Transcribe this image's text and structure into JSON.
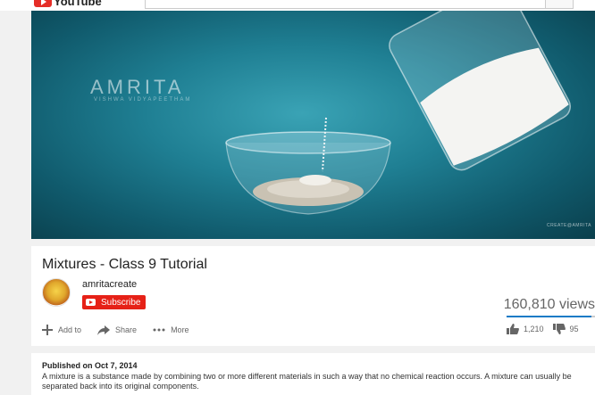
{
  "header": {
    "logo_text": "YouTube",
    "search_placeholder": ""
  },
  "video": {
    "brand": "AMRITA",
    "brand_sub": "VISHWA VIDYAPEETHAM",
    "watermark": "CREATE@AMRITA"
  },
  "info": {
    "title": "Mixtures - Class 9 Tutorial",
    "channel": "amritacreate",
    "subscribe_label": "Subscribe",
    "views": "160,810 views",
    "sentiment_ratio": 0.96,
    "actions": {
      "add_to": "Add to",
      "share": "Share",
      "more": "More"
    },
    "likes": "1,210",
    "dislikes": "95"
  },
  "description": {
    "published": "Published on Oct 7, 2014",
    "text": "A mixture is a substance made by combining two or more different materials in such a way that no chemical reaction occurs. A mixture can usually be separated back into its original components."
  },
  "icons": [
    "youtube-logo-icon",
    "plus-icon",
    "share-arrow-icon",
    "more-dots-icon",
    "thumbs-up-icon",
    "thumbs-down-icon"
  ],
  "colors": {
    "brand_red": "#e62117",
    "like_blue": "#167ac6",
    "video_teal": "#1f7f93"
  }
}
